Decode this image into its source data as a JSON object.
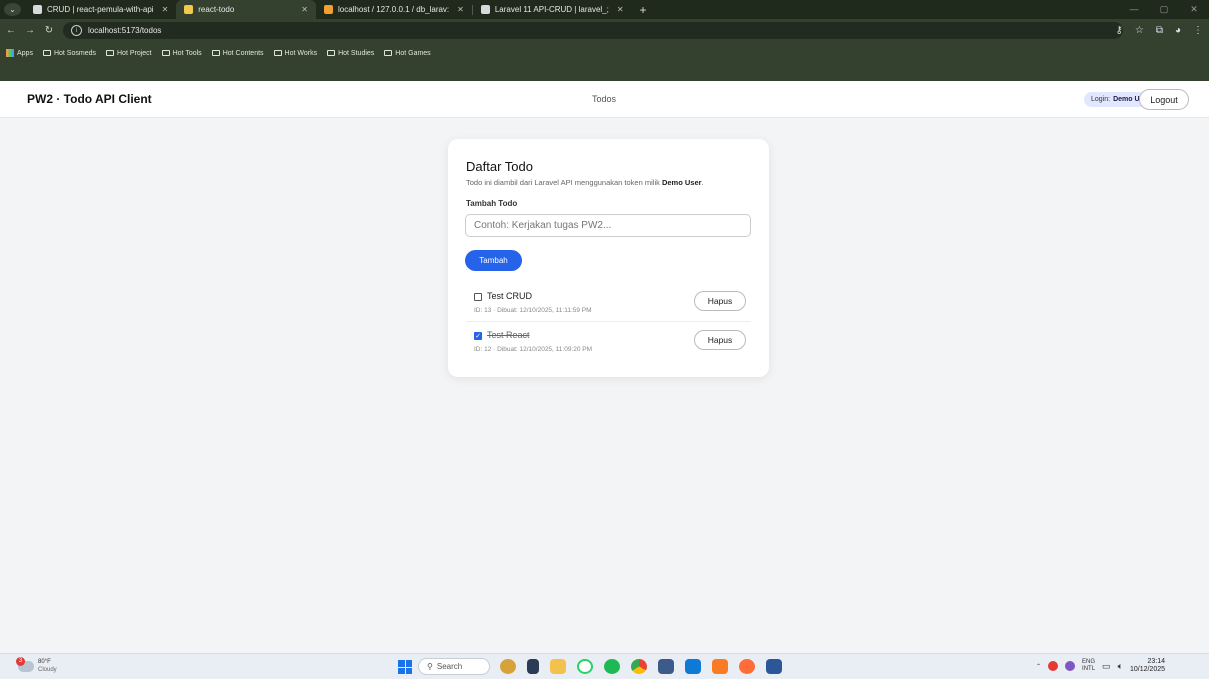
{
  "browser": {
    "tabs": [
      {
        "title": "CRUD | react-pemula-with-api",
        "fav_color": "#d9d9d9"
      },
      {
        "title": "react-todo",
        "fav_color": "#f2c94c"
      },
      {
        "title": "localhost / 127.0.0.1 / db_larav:",
        "fav_color": "#f0a030"
      },
      {
        "title": "Laravel 11 API-CRUD | laravel_;",
        "fav_color": "#d9d9d9"
      }
    ],
    "address": "localhost:5173/todos",
    "bookmarks": [
      "Apps",
      "Hot Sosmeds",
      "Hot Project",
      "Hot Tools",
      "Hot Contents",
      "Hot Works",
      "Hot Studies",
      "Hot Games"
    ]
  },
  "header": {
    "brand": "PW2 · Todo API Client",
    "nav_link": "Todos",
    "login_label": "Login:",
    "login_user": "Demo User",
    "logout_label": "Logout"
  },
  "card": {
    "title": "Daftar Todo",
    "description_prefix": "Todo ini diambil dari Laravel API menggunakan token milik",
    "description_user": "Demo User",
    "description_suffix": ".",
    "field_label": "Tambah Todo",
    "input_placeholder": "Contoh: Kerjakan tugas PW2...",
    "add_button": "Tambah",
    "todos": [
      {
        "title": "Test CRUD",
        "meta": "ID: 13 · Dibuat: 12/10/2025, 11:11:59 PM",
        "done": false,
        "delete_label": "Hapus"
      },
      {
        "title": "Test React",
        "meta": "ID: 12 · Dibuat: 12/10/2025, 11:09:20 PM",
        "done": true,
        "delete_label": "Hapus"
      }
    ]
  },
  "taskbar": {
    "weather_badge": "3",
    "weather_temp": "80°F",
    "weather_desc": "Cloudy",
    "search_placeholder": "Search",
    "lang_top": "ENG",
    "lang_bottom": "INTL",
    "time": "23:14",
    "date": "10/12/2025"
  }
}
